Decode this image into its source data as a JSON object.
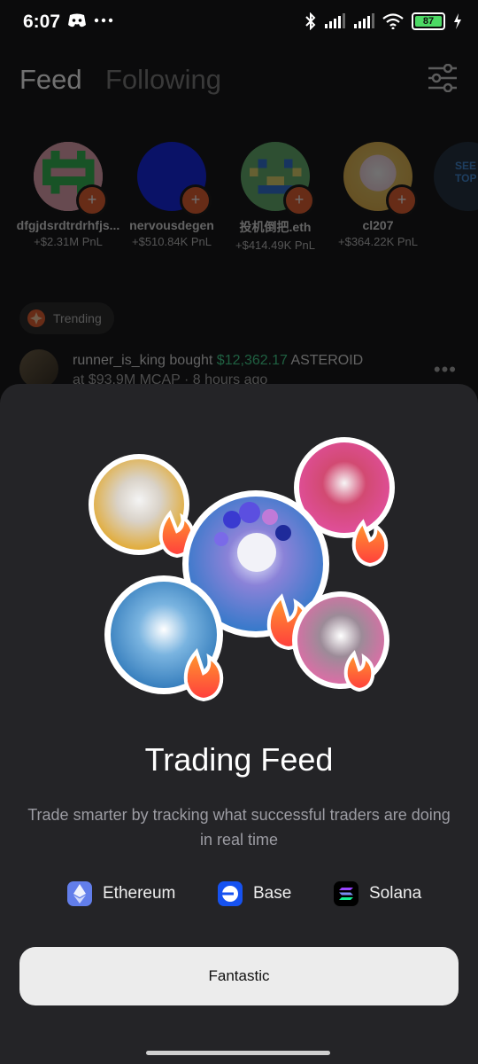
{
  "status_bar": {
    "time": "6:07",
    "left_icons": [
      "discord-icon",
      "more-dots-icon"
    ],
    "right_icons": [
      "bluetooth-icon",
      "signal-icon",
      "signal-icon",
      "wifi-icon",
      "battery-icon",
      "charging-icon"
    ],
    "battery": "87",
    "battery_color": "#4cd964"
  },
  "header": {
    "tabs": [
      {
        "label": "Feed",
        "active": true
      },
      {
        "label": "Following",
        "active": false
      }
    ],
    "filter_icon": "sliders-icon"
  },
  "top_traders": {
    "items": [
      {
        "name": "dfgjdsrdtrdrhfjs...",
        "pnl": "+$2.31M PnL"
      },
      {
        "name": "nervousdegen",
        "pnl": "+$510.84K PnL"
      },
      {
        "name": "投机倒把.eth",
        "pnl": "+$414.49K PnL"
      },
      {
        "name": "cl207",
        "pnl": "+$364.22K PnL"
      }
    ],
    "see_top_label_1": "SEE",
    "see_top_label_2": "TOP"
  },
  "trending": {
    "label": "Trending"
  },
  "activity": {
    "user": "runner_is_king",
    "action": "bought",
    "amount": "$12,362.17",
    "token": "ASTEROID",
    "line2": "at $93.9M MCAP · 8 hours ago"
  },
  "sheet": {
    "title": "Trading Feed",
    "description": "Trade smarter by tracking what successful traders are doing in real time",
    "chains": [
      {
        "label": "Ethereum",
        "icon": "ethereum-icon",
        "color": "#627eea"
      },
      {
        "label": "Base",
        "icon": "base-icon",
        "color": "#1652f0"
      },
      {
        "label": "Solana",
        "icon": "solana-icon",
        "color": "#000000"
      }
    ],
    "cta_label": "Fantastic"
  },
  "colors": {
    "accent_orange": "#e85c2a",
    "pnl_green": "#3dd68c",
    "sheet_bg": "#242427"
  }
}
